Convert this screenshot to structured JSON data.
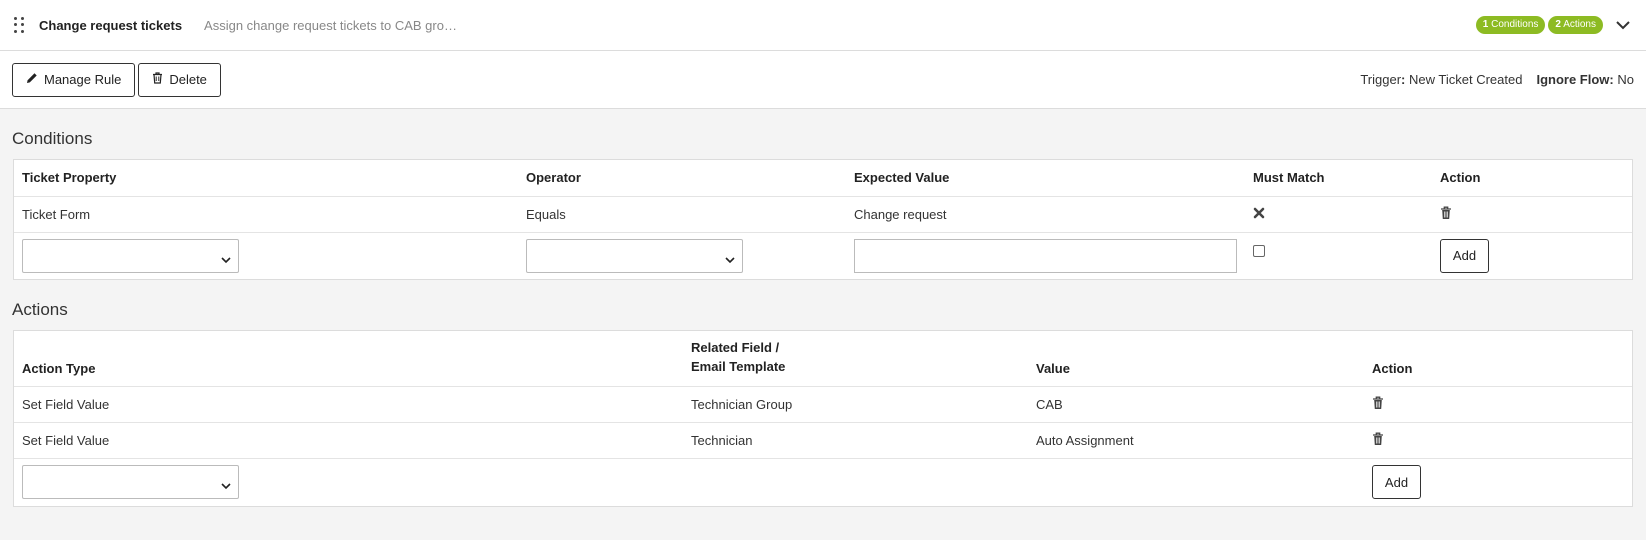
{
  "header": {
    "rule_name": "Change request tickets",
    "rule_description": "Assign change request tickets to CAB gro…",
    "conditions_badge_count": "1",
    "conditions_badge_label": "Conditions",
    "actions_badge_count": "2",
    "actions_badge_label": "Actions",
    "expand_icon": "chevron-down-icon"
  },
  "toolbar": {
    "manage_rule_label": "Manage Rule",
    "delete_label": "Delete",
    "trigger_label": "Trigger",
    "trigger_value": "New Ticket Created",
    "ignore_flow_label": "Ignore Flow",
    "ignore_flow_value": "No"
  },
  "conditions": {
    "title": "Conditions",
    "columns": [
      "Ticket Property",
      "Operator",
      "Expected Value",
      "Must Match",
      "Action"
    ],
    "rows": [
      {
        "property": "Ticket Form",
        "operator": "Equals",
        "expected": "Change request",
        "must_match_icon": "x-mark-icon",
        "action_icon": "trash-icon"
      }
    ],
    "new_row": {
      "property": "",
      "operator": "",
      "expected": "",
      "must_match": false,
      "add_label": "Add"
    }
  },
  "actions": {
    "title": "Actions",
    "columns": [
      "Action Type",
      "Related Field /",
      "Email Template",
      "Value",
      "Action"
    ],
    "rows": [
      {
        "type": "Set Field Value",
        "field": "Technician Group",
        "value": "CAB",
        "action_icon": "trash-icon"
      },
      {
        "type": "Set Field Value",
        "field": "Technician",
        "value": "Auto Assignment",
        "action_icon": "trash-icon"
      }
    ],
    "new_row": {
      "type": "",
      "add_label": "Add"
    }
  },
  "colors": {
    "badge": "#8dbb23",
    "border": "#dcdcdc",
    "background": "#f4f4f4"
  }
}
